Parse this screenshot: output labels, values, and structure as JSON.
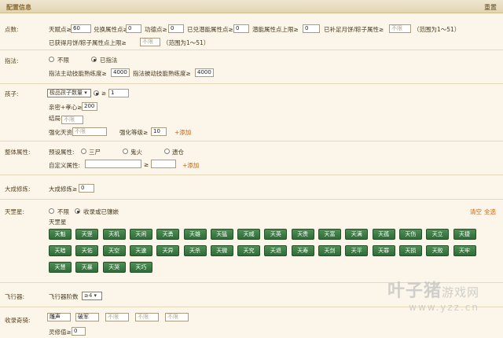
{
  "header": {
    "title": "配置信息",
    "reset": "重置"
  },
  "points": {
    "label": "点数:",
    "talent_label": "天赋点≥",
    "talent_value": "60",
    "exchange_label": "兑换属性点≥",
    "exchange_value": "0",
    "skill_label": "功德点≥",
    "skill_value": "0",
    "potential_label": "已兑潜能属性点≥",
    "potential_value": "0",
    "potential_cap_label": "潜能属性点上限≥",
    "potential_cap_value": "0",
    "mooncake_label": "已补足月饼/粽子属性≥",
    "mooncake_placeholder": "不限",
    "range1": "（范围为1～51）",
    "mooncake_cap_label": "已获得月饼/粽子属性点上限≥",
    "mooncake_cap_placeholder": "不限",
    "range2": "（范围为1～51）"
  },
  "xinfa": {
    "label": "指法:",
    "opt_any": "不限",
    "opt_has": "已指法",
    "active_label": "指法主动技能熟练度≥",
    "active_value": "4000",
    "passive_label": "指法被动技能熟练度≥",
    "passive_value": "4000"
  },
  "child": {
    "label": "孩子:",
    "select": "极品孩子数量",
    "count_value": "1",
    "fav_label": "亲密+孝心≥",
    "fav_value": "200",
    "ending_label": "结局",
    "ending_placeholder": "不限",
    "talent_label": "强化天资",
    "talent_placeholder": "不限",
    "level_label": "强化等级≥",
    "level_value": "10",
    "add": "+添加"
  },
  "overall": {
    "label": "整体属性:",
    "preset_label": "预设属性:",
    "opt1": "三尸",
    "opt2": "鬼火",
    "opt3": "遗仓",
    "custom_label": "自定义属性:",
    "ge": "≥",
    "add": "+添加"
  },
  "dacheng": {
    "label": "大成修炼:",
    "inner_label": "大成修炼≥",
    "value": "0"
  },
  "tiangang": {
    "label": "天罡星:",
    "opt_any": "不限",
    "opt_collected": "收录或已镶嵌",
    "clear": "清空",
    "all": "全选",
    "sub_label": "天罡星",
    "stars": [
      "天魁",
      "天罡",
      "天机",
      "天闲",
      "天勇",
      "天雄",
      "天猛",
      "天威",
      "天英",
      "天贵",
      "天富",
      "天满",
      "天孤",
      "天伤",
      "天立",
      "天捷",
      "天暗",
      "天佑",
      "天空",
      "天速",
      "天异",
      "天杀",
      "天微",
      "天究",
      "天退",
      "天寿",
      "天剑",
      "天平",
      "天罪",
      "天损",
      "天败",
      "天牢",
      "天慧",
      "天暴",
      "天哭",
      "天巧"
    ]
  },
  "aircraft": {
    "label": "飞行器:",
    "inner_label": "飞行器阶数",
    "select": "≥4"
  },
  "collection": {
    "label": "收录奇骑:",
    "slot1": "雕声",
    "slot2": "破军",
    "slot3_ph": "不限",
    "slot4_ph": "不限",
    "slot5_ph": "不限",
    "lingxiu_label": "灵修值≥",
    "lingxiu_value": "0"
  },
  "watermark": {
    "brand": "叶子猪",
    "sub": "游戏网",
    "url": "www.yzz.cn"
  },
  "colors": {
    "accent": "#c0631a",
    "star_bg": "#3f7d47",
    "header_bg": "#e8dcbe"
  }
}
